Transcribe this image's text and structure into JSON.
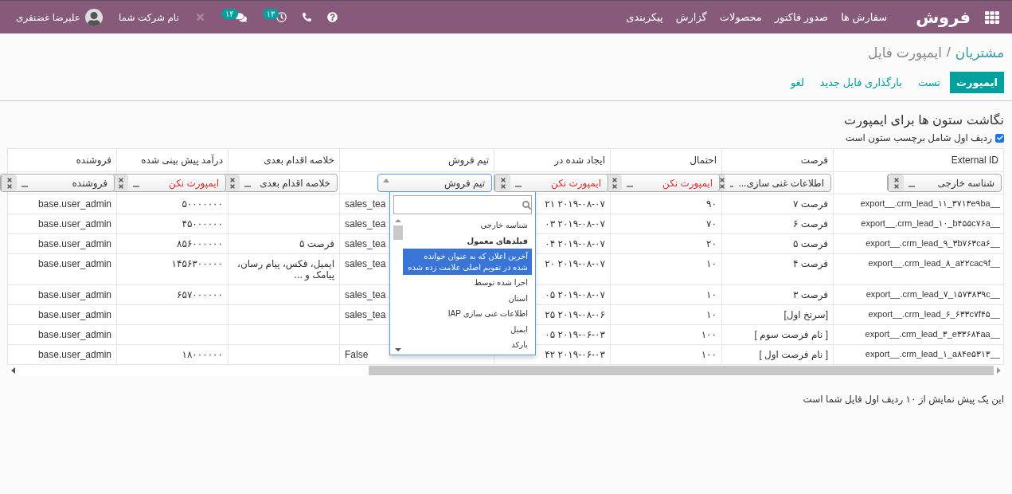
{
  "navbar": {
    "brand": "فروش",
    "menu": [
      "سفارش ها",
      "صدور فاکتور",
      "محصولات",
      "گزارش",
      "پیکربندی"
    ],
    "activity_count": "۱۳",
    "message_count": "۱۴",
    "company": "نام شرکت شما",
    "user": "علیرضا غضنفری"
  },
  "breadcrumb": [
    {
      "label": "مشتریان",
      "kind": "link"
    },
    {
      "label": "ایمپورت فایل",
      "kind": "current"
    }
  ],
  "breadcrumb_separator": "/",
  "buttons": [
    {
      "label": "ایمپورت",
      "kind": "primary"
    },
    {
      "label": "تست",
      "kind": "link"
    },
    {
      "label": "بارگذاری فایل جدید",
      "kind": "link"
    },
    {
      "label": "لغو",
      "kind": "link"
    }
  ],
  "section_title": "نگاشت ستون ها برای ایمپورت",
  "header_option": {
    "label": "ردیف اول شامل برچسب ستون است",
    "checked": true
  },
  "table": {
    "columns": [
      {
        "label": "External ID",
        "field": {
          "value": "شناسه خارجی",
          "kind": "field",
          "open": false
        }
      },
      {
        "label": "فرصت",
        "field": {
          "value": "اطلاعات غنی سازی...",
          "kind": "field",
          "open": false
        }
      },
      {
        "label": "احتمال",
        "field": {
          "value": "ایمپورت نکن",
          "kind": "skip",
          "open": false
        }
      },
      {
        "label": "ایجاد شده در",
        "field": {
          "value": "ایمپورت نکن",
          "kind": "skip",
          "open": false
        }
      },
      {
        "label": "تیم فروش",
        "field": {
          "value": "تیم فروش",
          "kind": "field",
          "open": true,
          "options": [
            {
              "label": "شناسه خارجی",
              "kind": "option",
              "selected": false
            },
            {
              "label": "فیلدهای معمول",
              "kind": "group",
              "selected": false
            },
            {
              "label": "آخرین اعلان که به عنوان خوانده شده در تقویم اصلی علامت زده شده",
              "kind": "option",
              "selected": true
            },
            {
              "label": "اجرا شده توسط",
              "kind": "option",
              "selected": false
            },
            {
              "label": "استان",
              "kind": "option",
              "selected": false
            },
            {
              "label": "اطلاعات غنی سازی IAP",
              "kind": "option",
              "selected": false
            },
            {
              "label": "ایمیل",
              "kind": "option",
              "selected": false
            },
            {
              "label": "بارکد",
              "kind": "option",
              "selected": false
            }
          ]
        }
      },
      {
        "label": "خلاصه اقدام بعدی",
        "field": {
          "value": "خلاصه اقدام بعدی",
          "kind": "field",
          "open": false
        }
      },
      {
        "label": "درآمد پیش بینی شده",
        "field": {
          "value": "ایمپورت نکن",
          "kind": "skip",
          "open": false
        }
      },
      {
        "label": "فروشنده",
        "field": {
          "value": "فروشنده",
          "kind": "field",
          "open": false
        }
      }
    ],
    "rows": [
      [
        "__export__.crm_lead_۱۱_۳۷۱۳e۹ba",
        "فرصت ۷",
        "۹۰",
        "۲۰۱۹-۰۸-۰۷ ۲۱",
        "sales_tea",
        null,
        "۵۰۰۰۰۰۰۰",
        "base.user_admin"
      ],
      [
        "__export__.crm_lead_۱۰_b۴۵۵c۷۶a",
        "فرصت ۶",
        "۷۰",
        "۲۰۱۹-۰۸-۰۷ ۰۳",
        "sales_tea",
        null,
        "۴۵۰۰۰۰۰۰",
        "base.user_admin"
      ],
      [
        "__export__.crm_lead_۹_۳b۷۶۳ca۶",
        "فرصت ۵",
        "۲۰",
        "۲۰۱۹-۰۸-۰۷ ۰۴",
        "sales_tea",
        "فرصت ۵",
        "۸۵۶۰۰۰۰۰۰",
        "base.user_admin"
      ],
      [
        "__export__.crm_lead_۸_a۲۲cac۹f",
        "فرصت ۴",
        "۱۰",
        "۲۰۱۹-۰۸-۰۷ ۲۰",
        "sales_tea",
        "ایمیل، فکس، پیام رسان، پیامک و ...",
        "۱۴۵۶۳۰۰۰۰۰",
        "base.user_admin"
      ],
      [
        "__export__.crm_lead_۷_۱۵۷۳۸۳۹c",
        "فرصت ۳",
        "۱۰",
        "۲۰۱۹-۰۸-۰۷ ۰۵",
        "sales_tea",
        null,
        "۶۵۷۰۰۰۰۰۰",
        "base.user_admin"
      ],
      [
        "__export__.crm_lead_۶_۶۳۳c۷f۴۵",
        "[سرنخ اول]",
        "۱۰",
        "۲۰۱۹-۰۸-۰۶ ۲۵",
        "sales_tea",
        null,
        null,
        "base.user_admin"
      ],
      [
        "__export__.crm_lead_۳_e۳۳۶۸۴aa",
        "[ نام فرصت سوم ]",
        "۱۰۰",
        "۲۰۱۹-۰۶-۰۳ ۰۵",
        null,
        null,
        null,
        "base.user_admin"
      ],
      [
        "__export__.crm_lead_۱_a۸۴e۵۳۱۳",
        "[ نام فرصت اول ]",
        "۱۰۰",
        "۲۰۱۹-۰۶-۰۳ ۴۲",
        "False",
        null,
        "۱۸۰۰۰۰۰۰",
        "base.user_admin"
      ]
    ]
  },
  "footer_note": "این یک پیش نمایش از ۱۰ ردیف اول فایل شما است"
}
